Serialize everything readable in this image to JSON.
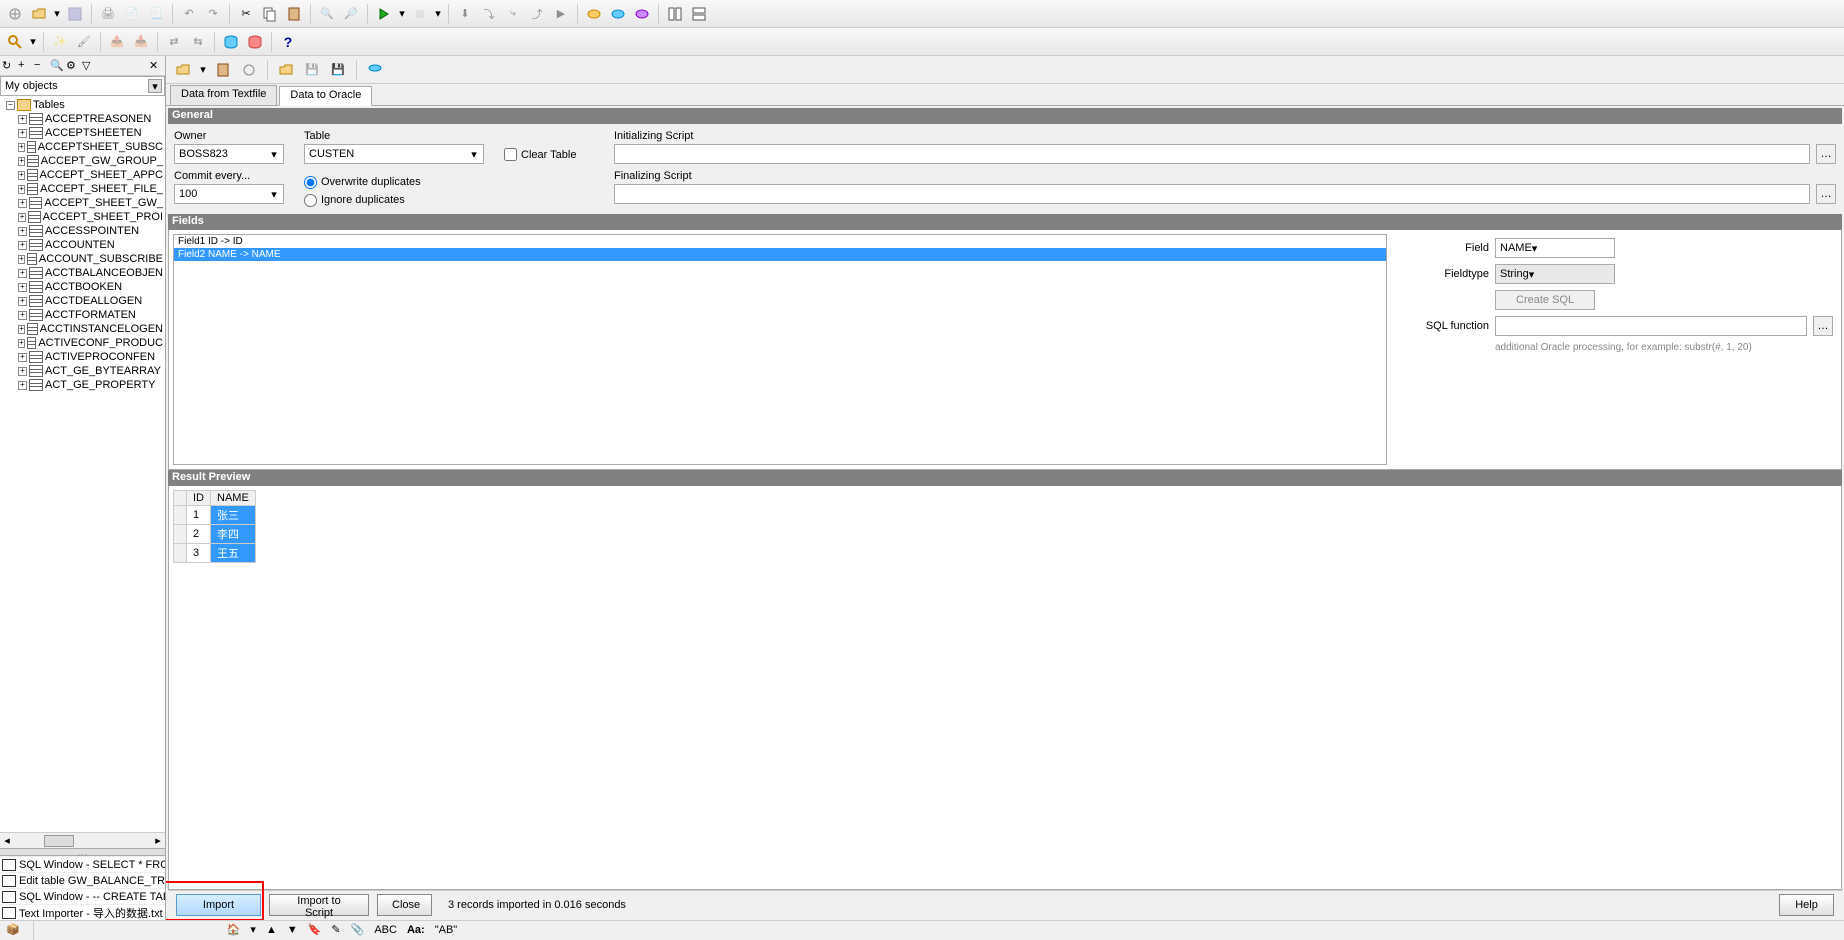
{
  "toolbar1_icons": [
    "new",
    "open",
    "dropdown",
    "save",
    "sep",
    "print",
    "print-preview",
    "print-setup",
    "sep",
    "undo",
    "redo",
    "sep",
    "cut",
    "copy",
    "paste",
    "sep",
    "find",
    "find-next",
    "sep",
    "run",
    "dropdown",
    "step",
    "dropdown",
    "sep",
    "break",
    "next",
    "into",
    "out",
    "sep",
    "exec1",
    "exec2",
    "exec3",
    "sep",
    "tile",
    "cascade"
  ],
  "toolbar2_icons": [
    "search",
    "dropdown",
    "sep",
    "highlight",
    "brush",
    "sep",
    "paint1",
    "paint2",
    "sep",
    "db-in",
    "db-out",
    "sep",
    "help"
  ],
  "left": {
    "toolbar_icons": [
      "refresh",
      "plus",
      "minus",
      "find",
      "settings",
      "filter"
    ],
    "dropdown": "My objects",
    "root": "Tables",
    "tables": [
      "ACCEPTREASONEN",
      "ACCEPTSHEETEN",
      "ACCEPTSHEET_SUBSC",
      "ACCEPT_GW_GROUP_",
      "ACCEPT_SHEET_APPC",
      "ACCEPT_SHEET_FILE_",
      "ACCEPT_SHEET_GW_",
      "ACCEPT_SHEET_PROI",
      "ACCESSPOINTEN",
      "ACCOUNTEN",
      "ACCOUNT_SUBSCRIBE",
      "ACCTBALANCEOBJEN",
      "ACCTBOOKEN",
      "ACCTDEALLOGEN",
      "ACCTFORMATEN",
      "ACCTINSTANCELOGEN",
      "ACTIVECONF_PRODUC",
      "ACTIVEPROCONFEN",
      "ACT_GE_BYTEARRAY",
      "ACT_GE_PROPERTY"
    ],
    "windows": [
      "SQL Window - SELECT * FROM DBTE",
      "Edit table GW_BALANCE_TRANSFER",
      "SQL Window - -- CREATE TABLE CRI",
      "Text Importer - 导入的数据.txt"
    ]
  },
  "tabs": [
    "Data from Textfile",
    "Data to Oracle"
  ],
  "active_tab": 1,
  "general": {
    "title": "General",
    "owner_label": "Owner",
    "owner": "BOSS823",
    "table_label": "Table",
    "table": "CUSTEN",
    "clear_table": "Clear Table",
    "commit_label": "Commit every...",
    "commit_value": "100",
    "overwrite": "Overwrite duplicates",
    "ignore": "Ignore duplicates",
    "init_label": "Initializing Script",
    "final_label": "Finalizing Script"
  },
  "fields": {
    "title": "Fields",
    "rows": [
      {
        "text": "Field1  ID  ->  ID",
        "selected": false
      },
      {
        "text": "Field2  NAME  ->  NAME",
        "selected": true
      }
    ],
    "field_label": "Field",
    "field_value": "NAME",
    "type_label": "Fieldtype",
    "type_value": "String",
    "create_sql": "Create SQL",
    "sqlfn_label": "SQL function",
    "hint": "additional Oracle processing, for example: substr(#, 1, 20)"
  },
  "result": {
    "title": "Result Preview",
    "cols": [
      "ID",
      "NAME"
    ],
    "rows": [
      {
        "id": "1",
        "name": "张三"
      },
      {
        "id": "2",
        "name": "李四"
      },
      {
        "id": "3",
        "name": "王五"
      }
    ]
  },
  "buttons": {
    "import": "Import",
    "import_script": "Import to Script",
    "close": "Close",
    "help": "Help",
    "status": "3 records imported in 0.016 seconds"
  },
  "statusbar": {
    "caret": "▼",
    "icons": [
      "home",
      "up",
      "down",
      "bookmark",
      "layer",
      "edit",
      "pin",
      "abc",
      "cap"
    ],
    "text": "\"AB\""
  }
}
